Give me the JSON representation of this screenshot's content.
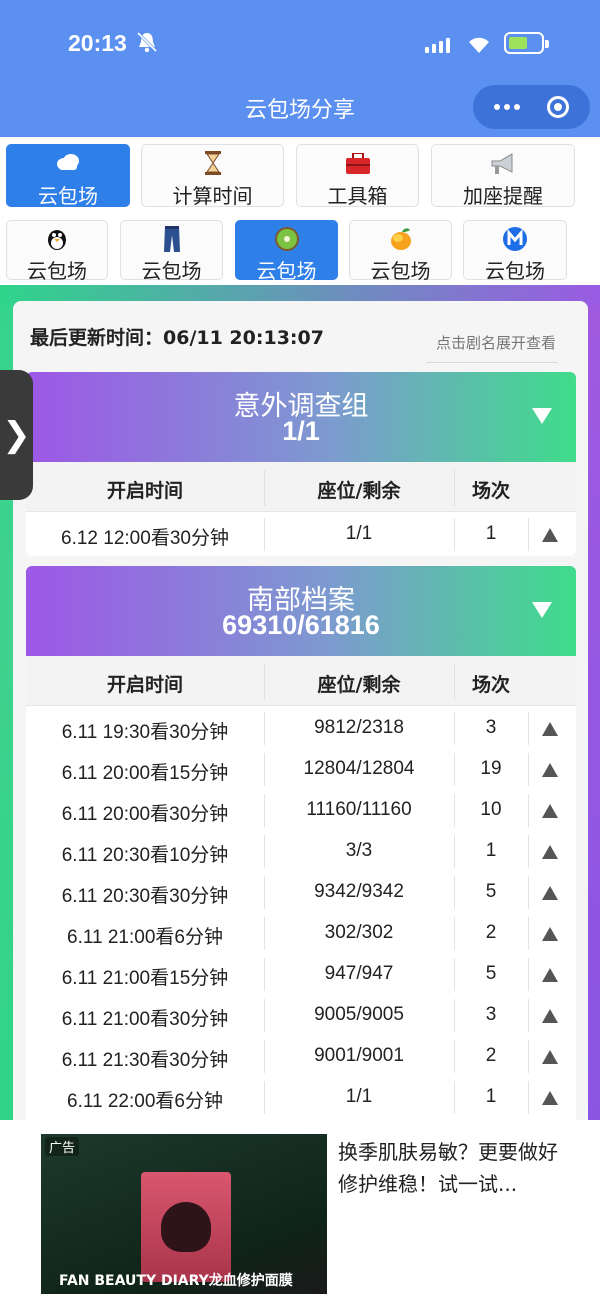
{
  "status_bar": {
    "time": "20:13"
  },
  "header": {
    "title": "云包场分享"
  },
  "main_tabs": [
    {
      "label": "云包场",
      "icon": "cloud-icon",
      "active": true
    },
    {
      "label": "计算时间",
      "icon": "hourglass-icon",
      "active": false
    },
    {
      "label": "工具箱",
      "icon": "toolbox-icon",
      "active": false
    },
    {
      "label": "加座提醒",
      "icon": "megaphone-icon",
      "active": false
    }
  ],
  "platform_tabs": [
    {
      "label": "云包场",
      "icon": "penguin-icon",
      "active": false
    },
    {
      "label": "云包场",
      "icon": "jeans-icon",
      "active": false
    },
    {
      "label": "云包场",
      "icon": "kiwi-icon",
      "active": true
    },
    {
      "label": "云包场",
      "icon": "mango-icon",
      "active": false
    },
    {
      "label": "云包场",
      "icon": "m-logo-icon",
      "active": false
    }
  ],
  "panel": {
    "updated": "最后更新时间：06/11 20:13:07",
    "hint": "点击剧名展开查看"
  },
  "table_headers": {
    "start": "开启时间",
    "seats": "座位/剩余",
    "sessions": "场次"
  },
  "cards": [
    {
      "title": "意外调查组",
      "count": "1/1",
      "rows": [
        {
          "start": "6.12 12:00看30分钟",
          "seats": "1/1",
          "sessions": "1"
        }
      ]
    },
    {
      "title": "南部档案",
      "count": "69310/61816",
      "rows": [
        {
          "start": "6.11 19:30看30分钟",
          "seats": "9812/2318",
          "sessions": "3"
        },
        {
          "start": "6.11 20:00看15分钟",
          "seats": "12804/12804",
          "sessions": "19"
        },
        {
          "start": "6.11 20:00看30分钟",
          "seats": "11160/11160",
          "sessions": "10"
        },
        {
          "start": "6.11 20:30看10分钟",
          "seats": "3/3",
          "sessions": "1"
        },
        {
          "start": "6.11 20:30看30分钟",
          "seats": "9342/9342",
          "sessions": "5"
        },
        {
          "start": "6.11 21:00看6分钟",
          "seats": "302/302",
          "sessions": "2"
        },
        {
          "start": "6.11 21:00看15分钟",
          "seats": "947/947",
          "sessions": "5"
        },
        {
          "start": "6.11 21:00看30分钟",
          "seats": "9005/9005",
          "sessions": "3"
        },
        {
          "start": "6.11 21:30看30分钟",
          "seats": "9001/9001",
          "sessions": "2"
        },
        {
          "start": "6.11 22:00看6分钟",
          "seats": "1/1",
          "sessions": "1"
        }
      ]
    }
  ],
  "ad": {
    "tag": "广告",
    "caption": "FAN BEAUTY DIARY龙血修护面膜",
    "text": "换季肌肤易敏？更要做好修护维稳！试一试..."
  }
}
